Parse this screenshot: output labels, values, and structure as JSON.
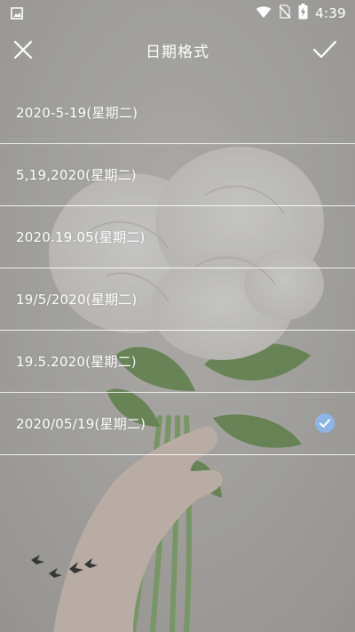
{
  "status_bar": {
    "time": "4:39",
    "icons": [
      "image-icon",
      "wifi-icon",
      "no-sim-icon",
      "battery-charging-icon"
    ]
  },
  "toolbar": {
    "title": "日期格式",
    "close_icon": "close-icon",
    "confirm_icon": "check-icon"
  },
  "formats": [
    {
      "label": "2020-5-19(星期二)",
      "selected": false
    },
    {
      "label": "5,19,2020(星期二)",
      "selected": false
    },
    {
      "label": "2020.19.05(星期二)",
      "selected": false
    },
    {
      "label": "19/5/2020(星期二)",
      "selected": false
    },
    {
      "label": "19.5.2020(星期二)",
      "selected": false
    },
    {
      "label": "2020/05/19(星期二)",
      "selected": true
    }
  ],
  "colors": {
    "text": "#ffffff",
    "selected_badge": "#8eb4e6",
    "overlay": "#464646"
  }
}
